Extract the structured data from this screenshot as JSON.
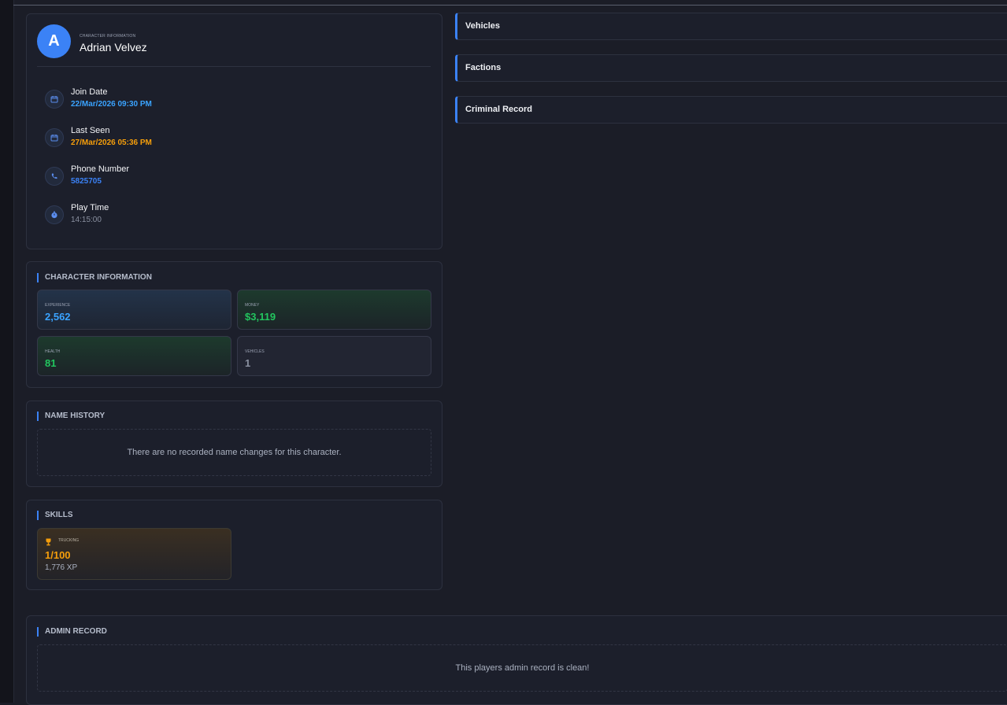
{
  "colors": {
    "accent": "#3b82f6",
    "join_date": "#3aa3ff",
    "last_seen": "#f59e0b",
    "phone": "#3b82f6",
    "play_time": "#8a90a0",
    "experience": "#3aa3ff",
    "money": "#22c55e",
    "health": "#22c55e",
    "vehicles": "#8a90a0"
  },
  "profile": {
    "avatar_letter": "A",
    "kicker": "CHARACTER INFORMATION",
    "name": "Adrian Velvez",
    "rows": [
      {
        "label": "Join Date",
        "value": "22/Mar/2026 09:30 PM",
        "icon": "calendar-icon"
      },
      {
        "label": "Last Seen",
        "value": "27/Mar/2026 05:36 PM",
        "icon": "calendar-icon"
      },
      {
        "label": "Phone Number",
        "value": "5825705",
        "icon": "phone-icon"
      },
      {
        "label": "Play Time",
        "value": "14:15:00",
        "icon": "stopwatch-icon"
      }
    ]
  },
  "character_info": {
    "title": "CHARACTER INFORMATION",
    "stats": {
      "experience": {
        "label": "EXPERIENCE",
        "value": "2,562"
      },
      "money": {
        "label": "MONEY",
        "value": "$3,119"
      },
      "health": {
        "label": "HEALTH",
        "value": "81"
      },
      "vehicles": {
        "label": "VEHICLES",
        "value": "1"
      }
    }
  },
  "name_history": {
    "title": "NAME HISTORY",
    "empty_text": "There are no recorded name changes for this character."
  },
  "skills": {
    "title": "SKILLS",
    "items": [
      {
        "name": "TRUCKING",
        "level": "1/100",
        "xp": "1,776 XP",
        "icon": "trophy-icon"
      }
    ]
  },
  "admin_record": {
    "title": "ADMIN RECORD",
    "empty_text": "This players admin record is clean!"
  },
  "accordions": [
    {
      "label": "Vehicles"
    },
    {
      "label": "Factions"
    },
    {
      "label": "Criminal Record"
    }
  ]
}
